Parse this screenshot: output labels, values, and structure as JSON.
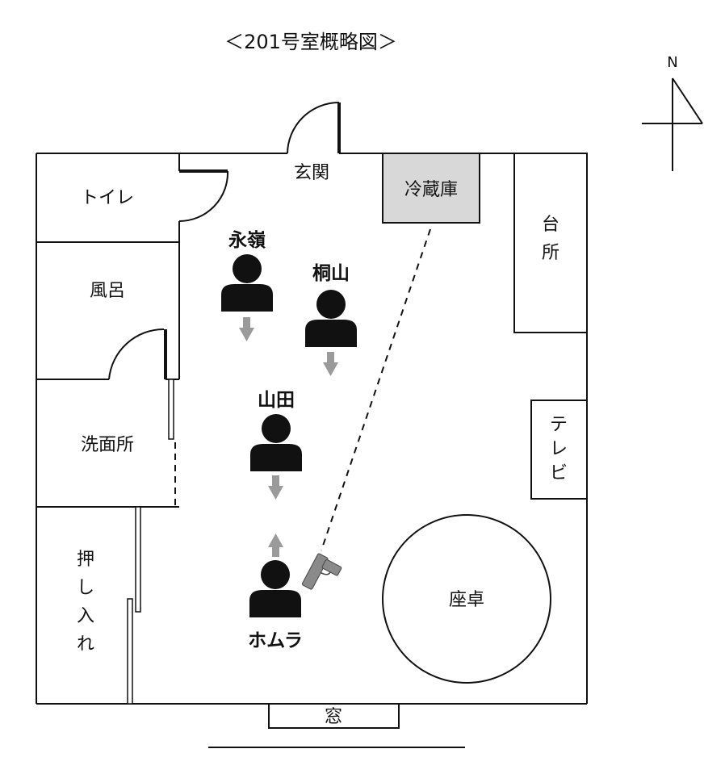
{
  "title": "＜201号室概略図＞",
  "compass": {
    "north_label": "N"
  },
  "rooms": {
    "toilet": "トイレ",
    "bath": "風呂",
    "washroom": "洗面所",
    "closet": [
      "押",
      "し",
      "入",
      "れ"
    ],
    "entrance": "玄関",
    "fridge": "冷蔵庫",
    "kitchen": [
      "台",
      "所"
    ],
    "tv": [
      "テ",
      "レ",
      "ビ"
    ],
    "table": "座卓",
    "window": "窓"
  },
  "people": [
    {
      "id": "nagamine",
      "name": "永嶺",
      "facing": "down"
    },
    {
      "id": "kiriyama",
      "name": "桐山",
      "facing": "down"
    },
    {
      "id": "yamada",
      "name": "山田",
      "facing": "down"
    },
    {
      "id": "homura",
      "name": "ホムラ",
      "facing": "up"
    }
  ],
  "colors": {
    "line": "#111111",
    "fridge_fill": "#d8d8d8",
    "arrow": "#9a9a9a",
    "gun": "#8a8a8a"
  }
}
